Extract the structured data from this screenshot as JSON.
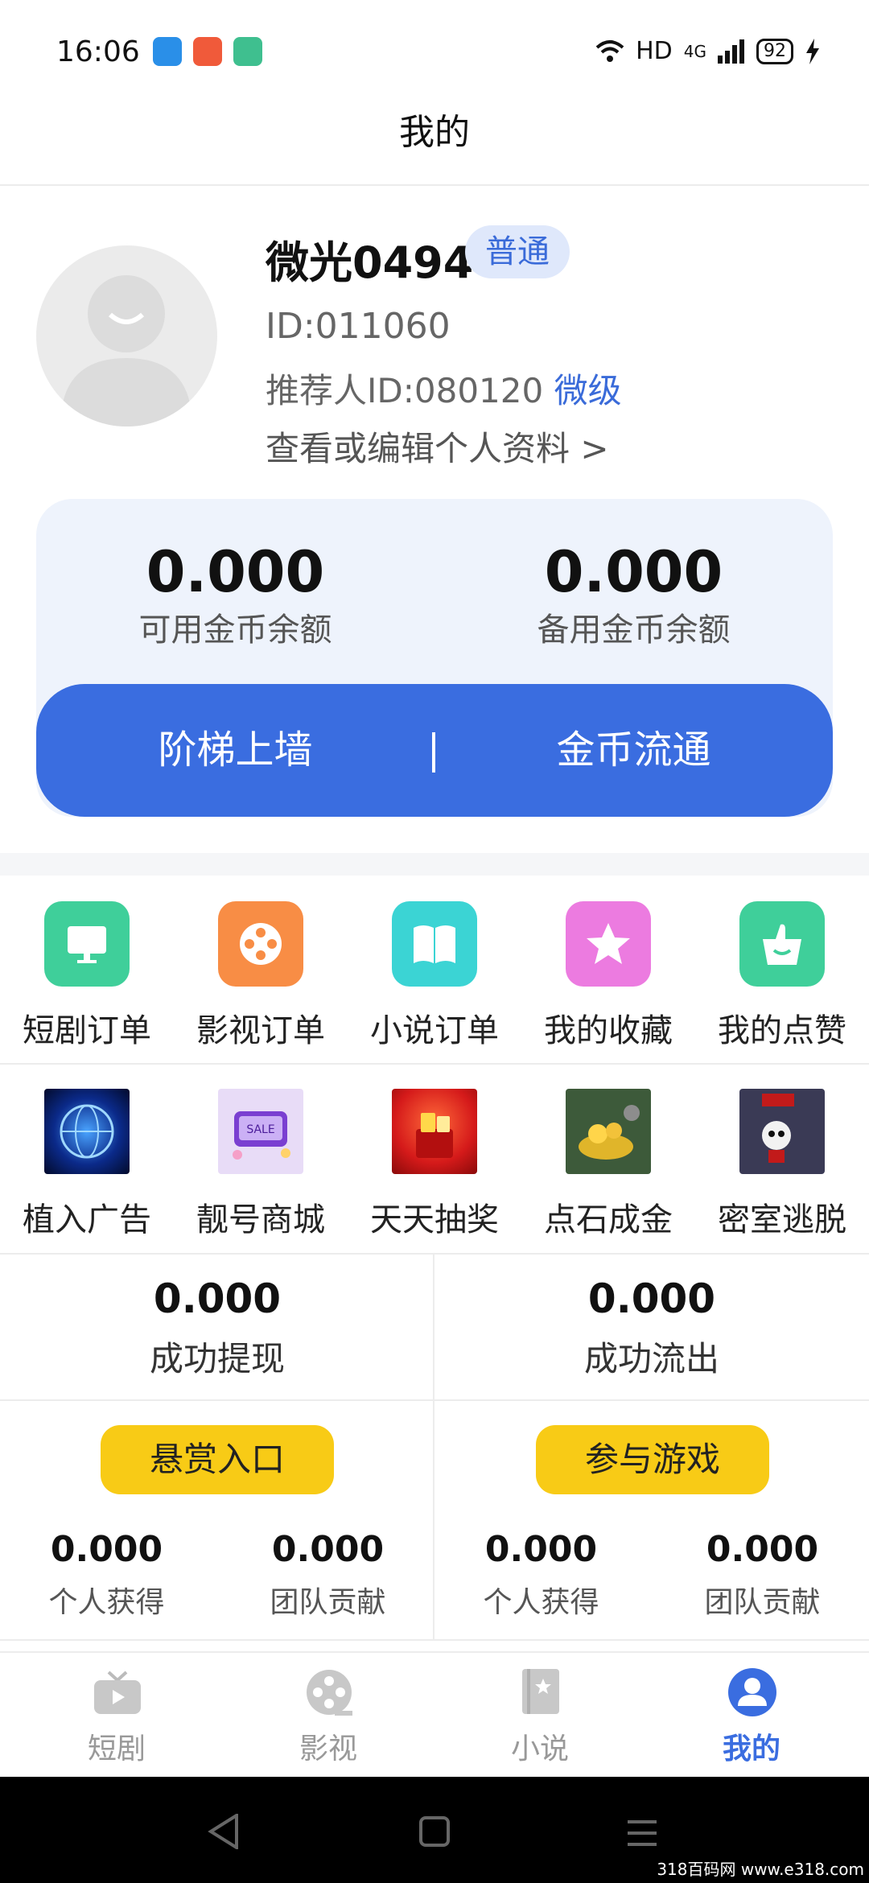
{
  "status_bar": {
    "time": "16:06",
    "network": "HD",
    "signal": "4G",
    "battery": "92"
  },
  "header": {
    "title": "我的"
  },
  "profile": {
    "username": "微光0494",
    "level": "普通",
    "id_text": "ID:011060",
    "referrer_text": "推荐人ID:080120",
    "referrer_level": "微级",
    "edit_link": "查看或编辑个人资料 >"
  },
  "balance": {
    "available_value": "0.000",
    "available_label": "可用金币余额",
    "backup_value": "0.000",
    "backup_label": "备用金币余额",
    "ladder_button": "阶梯上墙",
    "separator": "|",
    "circulate_button": "金币流通"
  },
  "orders_grid": [
    {
      "label": "短剧订单",
      "icon": "tv-icon",
      "color": "#3fcf9a"
    },
    {
      "label": "影视订单",
      "icon": "film-reel-icon",
      "color": "#f88d45"
    },
    {
      "label": "小说订单",
      "icon": "book-icon",
      "color": "#3bd4d4"
    },
    {
      "label": "我的收藏",
      "icon": "star-icon",
      "color": "#ec7be0"
    },
    {
      "label": "我的点赞",
      "icon": "thumbs-up-icon",
      "color": "#3fcf9a"
    }
  ],
  "apps_grid": [
    {
      "label": "植入广告",
      "icon": "globe-thumbnail"
    },
    {
      "label": "靓号商城",
      "icon": "sale-thumbnail"
    },
    {
      "label": "天天抽奖",
      "icon": "lottery-thumbnail"
    },
    {
      "label": "点石成金",
      "icon": "gold-thumbnail"
    },
    {
      "label": "密室逃脱",
      "icon": "escape-thumbnail"
    }
  ],
  "stats": {
    "withdraw_value": "0.000",
    "withdraw_label": "成功提现",
    "outflow_value": "0.000",
    "outflow_label": "成功流出"
  },
  "panels": [
    {
      "button": "悬赏入口",
      "personal_value": "0.000",
      "personal_label": "个人获得",
      "team_value": "0.000",
      "team_label": "团队贡献"
    },
    {
      "button": "参与游戏",
      "personal_value": "0.000",
      "personal_label": "个人获得",
      "team_value": "0.000",
      "team_label": "团队贡献"
    }
  ],
  "bottom_nav": [
    {
      "label": "短剧",
      "icon": "tv-icon"
    },
    {
      "label": "影视",
      "icon": "film-reel-icon"
    },
    {
      "label": "小说",
      "icon": "book-icon"
    },
    {
      "label": "我的",
      "icon": "user-icon",
      "active": true
    }
  ],
  "watermark": "318百码网 www.e318.com",
  "colors": {
    "accent": "#3a6de0",
    "badge_bg": "#dfe8fb",
    "yellow": "#f8cb16",
    "card_bg": "#eef3fc"
  }
}
